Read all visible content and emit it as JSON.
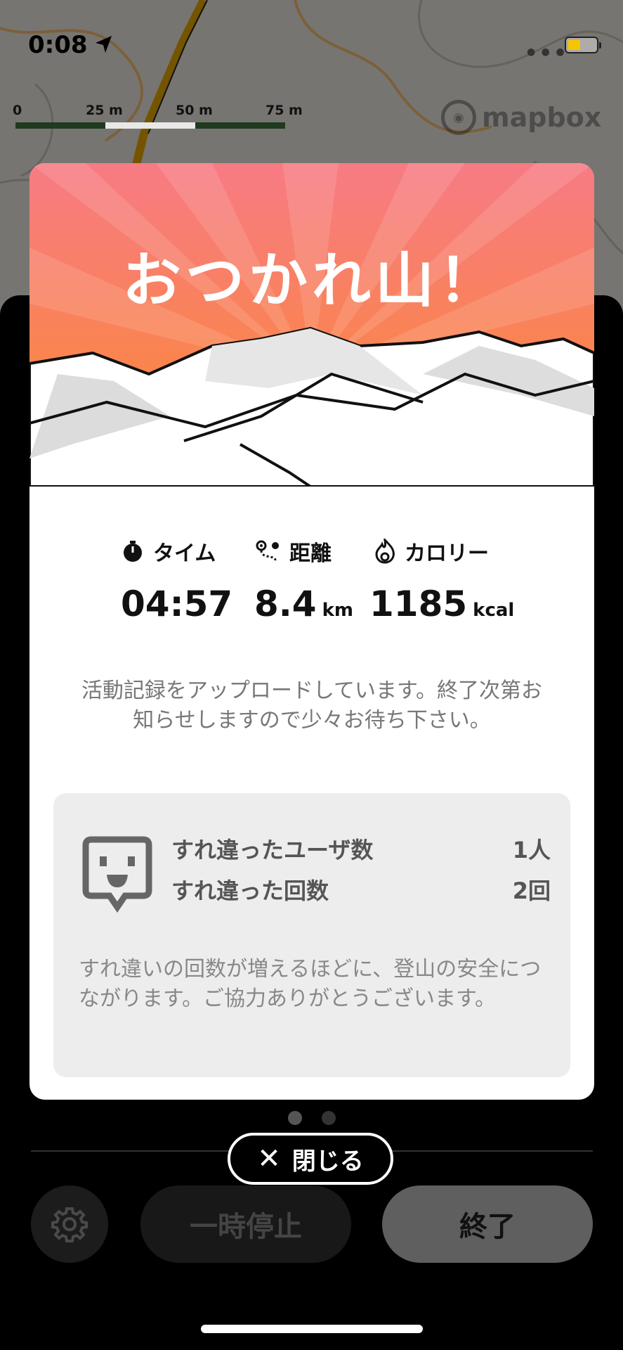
{
  "status_bar": {
    "time": "0:08",
    "location_icon": "location-arrow-icon",
    "battery_color": "#f6c500"
  },
  "map": {
    "scale_labels": [
      "0",
      "25 m",
      "50 m",
      "75 m"
    ],
    "attribution": "mapbox"
  },
  "card": {
    "title": "おつかれ山！",
    "stats": [
      {
        "label": "タイム",
        "icon": "stopwatch-icon",
        "value": "04:57",
        "unit": ""
      },
      {
        "label": "距離",
        "icon": "route-icon",
        "value": "8.4",
        "unit": "km"
      },
      {
        "label": "カロリー",
        "icon": "flame-icon",
        "value": "1185",
        "unit": "kcal"
      }
    ],
    "upload_message": "活動記録をアップロードしています。終了次第お知らせしますので少々お待ち下さい。",
    "passing": {
      "rows": [
        {
          "label": "すれ違ったユーザ数",
          "value": "1人"
        },
        {
          "label": "すれ違った回数",
          "value": "2回"
        }
      ],
      "note": "すれ違いの回数が増えるほどに、登山の安全につながります。ご協力ありがとうございます。"
    }
  },
  "pager": {
    "count": 2,
    "active_index": 0
  },
  "close_button": {
    "label": "閉じる"
  },
  "controls": {
    "pause_label": "一時停止",
    "finish_label": "終了"
  },
  "colors": {
    "hero_top": "#f77b84",
    "hero_bottom": "#fc8a2e",
    "accent_yellow": "#f6c500"
  }
}
